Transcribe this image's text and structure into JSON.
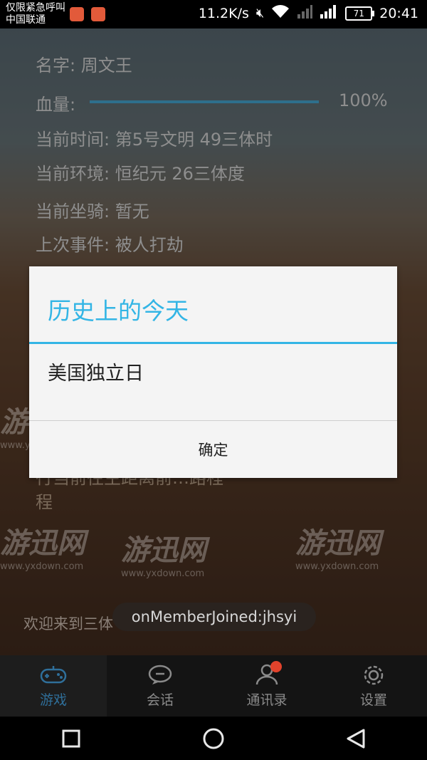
{
  "status_bar": {
    "carrier_line1": "仅限紧急呼叫",
    "carrier_line2": "中国联通",
    "net_speed": "11.2K/s",
    "battery": "71",
    "time": "20:41"
  },
  "game_info": {
    "name": "名字: 周文王",
    "hp_label": "血量:",
    "hp_value": "100%",
    "hp_fraction": 1.0,
    "time": "当前时间: 第5号文明 49三体时",
    "environment": "当前环境: 恒纪元 26三体度",
    "mount": "当前坐骑: 暂无",
    "last_event": "上次事件: 被人打劫"
  },
  "behind_text": {
    "line1": "行当前往主距离前…路程",
    "line2": "程"
  },
  "dialog": {
    "title": "历史上的今天",
    "message": "美国独立日",
    "confirm": "确定"
  },
  "welcome": "欢迎来到三体",
  "toast": "onMemberJoined:jhsyi",
  "watermark": {
    "text": "游迅网",
    "url": "www.yxdown.com"
  },
  "tabs": [
    {
      "label": "游戏",
      "icon": "gamepad-icon"
    },
    {
      "label": "会话",
      "icon": "chat-icon"
    },
    {
      "label": "通讯录",
      "icon": "contacts-icon"
    },
    {
      "label": "设置",
      "icon": "gear-icon"
    }
  ],
  "colors": {
    "accent": "#33b5e5",
    "tab_active": "#2f6f9a",
    "badge": "#e2432c"
  }
}
